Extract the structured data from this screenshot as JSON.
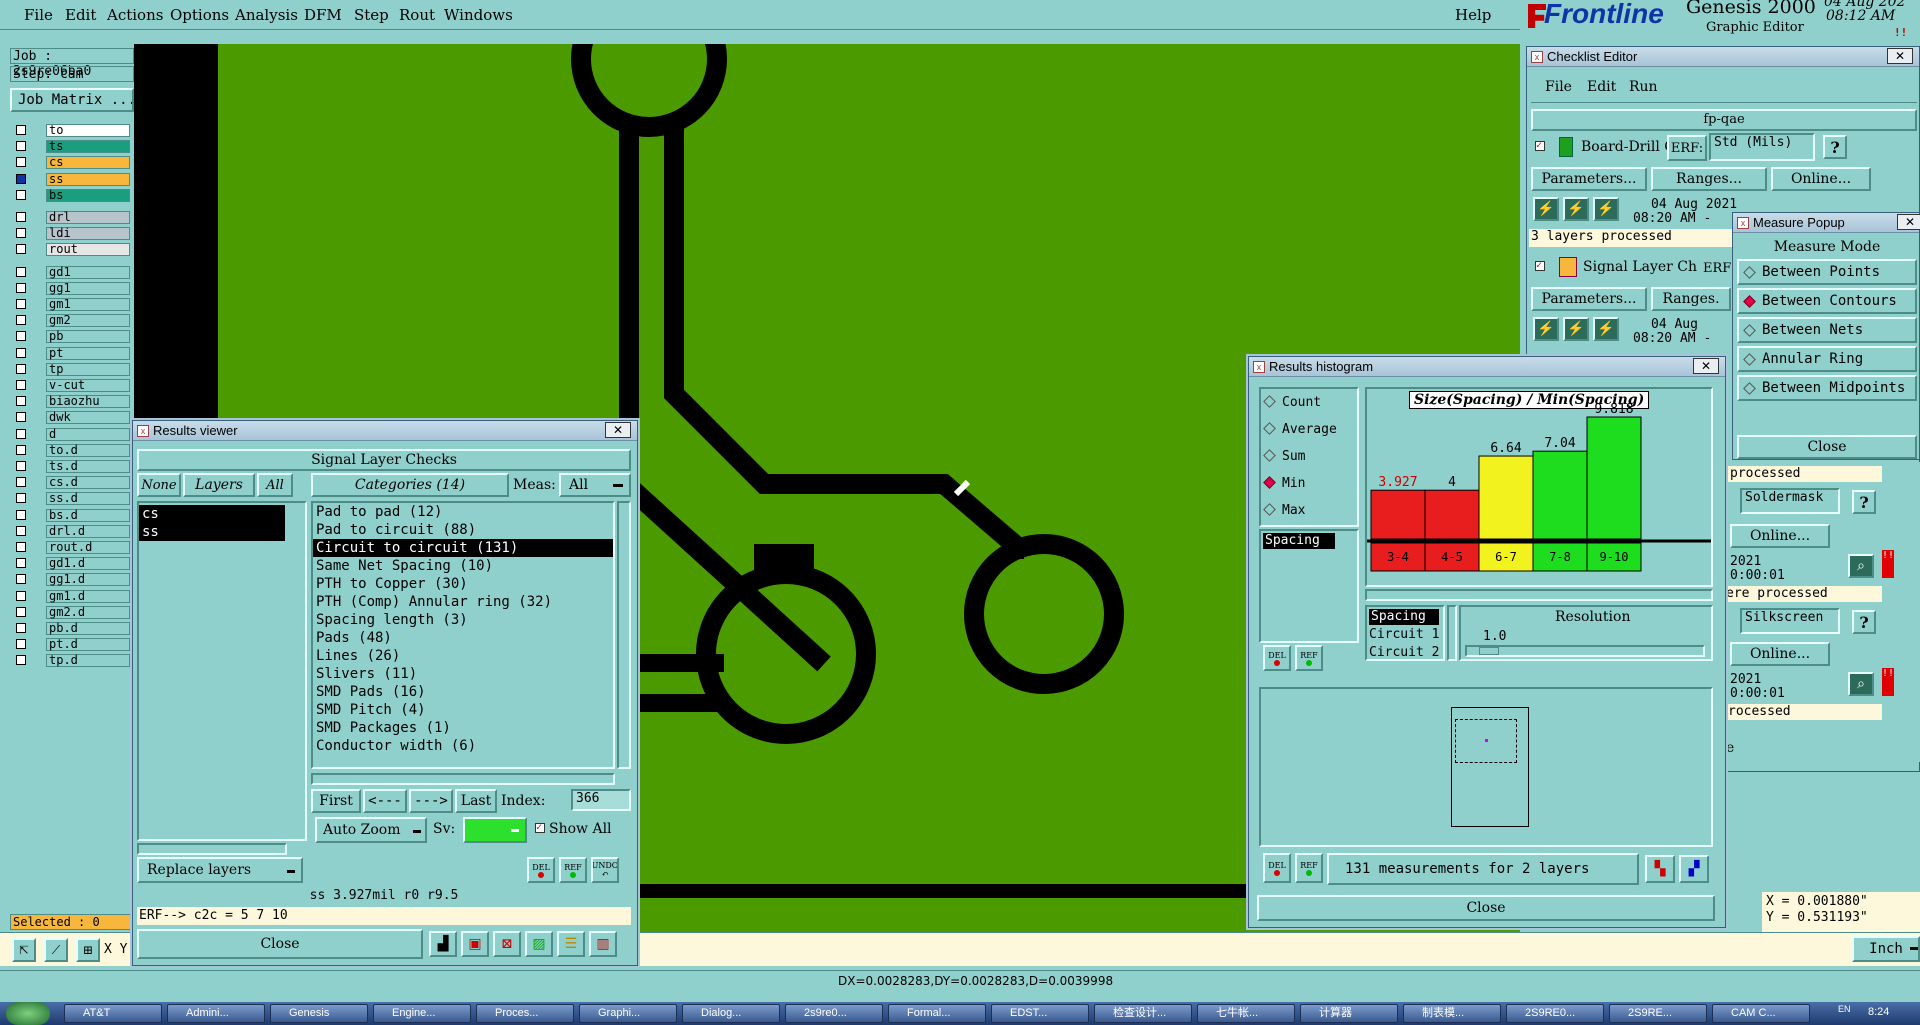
{
  "menu": [
    "File",
    "Edit",
    "Actions",
    "Options",
    "Analysis",
    "DFM",
    "Step",
    "Rout",
    "Windows"
  ],
  "help": "Help",
  "brand": {
    "name": "Frontline",
    "product": "Genesis 2000",
    "subtitle": "Graphic Editor",
    "date": "04 Aug 202",
    "time": "08:12 AM"
  },
  "job": {
    "job": "Job : 2s9re06ba0",
    "step": "Step: cam",
    "matrix": "Job Matrix ..."
  },
  "layers": [
    {
      "name": "to",
      "color": "#ffffff"
    },
    {
      "name": "ts",
      "color": "#1a9e7e"
    },
    {
      "name": "cs",
      "color": "#f6b73c"
    },
    {
      "name": "ss",
      "color": "#f6b73c"
    },
    {
      "name": "bs",
      "color": "#1a9e7e"
    },
    {
      "name": "drl",
      "color": "#b8c4cc"
    },
    {
      "name": "ldi",
      "color": "#b8c4cc"
    },
    {
      "name": "rout",
      "color": "#e6e6e6"
    },
    {
      "name": "gd1",
      "color": "#8fd0cc"
    },
    {
      "name": "gg1",
      "color": "#8fd0cc"
    },
    {
      "name": "gm1",
      "color": "#8fd0cc"
    },
    {
      "name": "gm2",
      "color": "#8fd0cc"
    },
    {
      "name": "pb",
      "color": "#8fd0cc"
    },
    {
      "name": "pt",
      "color": "#8fd0cc"
    },
    {
      "name": "tp",
      "color": "#8fd0cc"
    },
    {
      "name": "v-cut",
      "color": "#8fd0cc"
    },
    {
      "name": "biaozhu",
      "color": "#8fd0cc"
    },
    {
      "name": "dwk",
      "color": "#8fd0cc"
    },
    {
      "name": "d",
      "color": "#8fd0cc"
    },
    {
      "name": "to.d",
      "color": "#8fd0cc"
    },
    {
      "name": "ts.d",
      "color": "#8fd0cc"
    },
    {
      "name": "cs.d",
      "color": "#8fd0cc"
    },
    {
      "name": "ss.d",
      "color": "#8fd0cc"
    },
    {
      "name": "bs.d",
      "color": "#8fd0cc"
    },
    {
      "name": "drl.d",
      "color": "#8fd0cc"
    },
    {
      "name": "rout.d",
      "color": "#8fd0cc"
    },
    {
      "name": "gd1.d",
      "color": "#8fd0cc"
    },
    {
      "name": "gg1.d",
      "color": "#8fd0cc"
    },
    {
      "name": "gm1.d",
      "color": "#8fd0cc"
    },
    {
      "name": "gm2.d",
      "color": "#8fd0cc"
    },
    {
      "name": "pb.d",
      "color": "#8fd0cc"
    },
    {
      "name": "pt.d",
      "color": "#8fd0cc"
    },
    {
      "name": "tp.d",
      "color": "#8fd0cc"
    }
  ],
  "selected": "Selected : 0",
  "status_line": "DX=0.0028283,DY=0.0028283,D=0.0039998",
  "coords": {
    "x": "X = 0.001880\"",
    "y": "Y = 0.531193\""
  },
  "units": "Inch",
  "results_viewer": {
    "title": "Results viewer",
    "header": "Signal Layer Checks",
    "btn_none": "None",
    "btn_layers": "Layers",
    "btn_all": "All",
    "categories_btn": "Categories (14)",
    "meas_label": "Meas:",
    "meas_value": "All",
    "layer_list": [
      "cs",
      "ss"
    ],
    "categories": [
      "Pad to pad (12)",
      "Pad to circuit (88)",
      "Circuit to circuit (131)",
      "Same Net Spacing (10)",
      "PTH to Copper (30)",
      "PTH (Comp) Annular ring (32)",
      "Spacing length (3)",
      "Pads (48)",
      "Lines (26)",
      "Slivers (11)",
      "SMD Pads (16)",
      "SMD Pitch (4)",
      "SMD Packages (1)",
      "Conductor width (6)"
    ],
    "nav": {
      "first": "First",
      "prev": "<---",
      "next": "--->",
      "last": "Last",
      "index_label": "Index:",
      "index_value": "366"
    },
    "auto_zoom": "Auto Zoom",
    "sv": "Sv:",
    "show_all": "Show All",
    "replace_layers": "Replace layers",
    "del": "DEL",
    "ref": "REF",
    "undo": "UNDO",
    "measure_text": "ss 3.927mil  r0  r9.5",
    "erf": "ERF--> c2c = 5 7 10",
    "close": "Close"
  },
  "checklist": {
    "title": "Checklist Editor",
    "menu": [
      "File",
      "Edit",
      "Run"
    ],
    "name": "fp-qae",
    "check1": {
      "name": "Board-Drill Che",
      "erf": "ERF:",
      "std": "Std (Mils)",
      "params": "Parameters...",
      "ranges": "Ranges...",
      "online": "Online...",
      "date": "04 Aug 2021",
      "time": "08:20 AM -",
      "status": "3 layers processed"
    },
    "check2": {
      "name": "Signal Layer Ch",
      "erf": "ERF",
      "params": "Parameters...",
      "ranges": "Ranges.",
      "date": "04 Aug",
      "time": "08:20 AM -"
    },
    "partial": {
      "processed1": "processed",
      "soldermask": "Soldermask",
      "online1": "Online...",
      "date1": "2021",
      "time1": "0:00:01",
      "were": "ere processed",
      "silkscreen": "Silkscreen",
      "online2": "Online...",
      "date2": "2021",
      "time2": "0:00:01",
      "processed2": "rocessed",
      "e": "e"
    }
  },
  "measure_popup": {
    "title": "Measure Popup",
    "heading": "Measure Mode",
    "modes": [
      "Between Points",
      "Between Contours",
      "Between Nets",
      "Annular Ring",
      "Between Midpoints"
    ],
    "selected_index": 1,
    "close": "Close"
  },
  "histogram": {
    "title": "Results histogram",
    "modes": [
      "Count",
      "Average",
      "Sum",
      "Min",
      "Max"
    ],
    "selected_mode": "Min",
    "measure_list": [
      "Spacing"
    ],
    "chart_title": "Size(Spacing) / Min(Spacing)",
    "bars": [
      {
        "range": "3-4",
        "value": "3.927",
        "color": "#e81e1e",
        "label_color": "#d00000",
        "height": 0.4
      },
      {
        "range": "4-5",
        "value": "4",
        "color": "#e81e1e",
        "label_color": "#000000",
        "height": 0.4
      },
      {
        "range": "6-7",
        "value": "6.64",
        "color": "#f2f21e",
        "label_color": "#000000",
        "height": 0.68
      },
      {
        "range": "7-8",
        "value": "7.04",
        "color": "#1edc1e",
        "label_color": "#000000",
        "height": 0.72
      },
      {
        "range": "9-10",
        "value": "9.818",
        "color": "#1edc1e",
        "label_color": "#000000",
        "height": 1.0
      }
    ],
    "fields": [
      "Spacing",
      "Circuit 1",
      "Circuit 2"
    ],
    "resolution_label": "Resolution",
    "resolution_value": "1.0",
    "status": "131 measurements for 2 layers",
    "del": "DEL",
    "ref": "REF",
    "close": "Close"
  },
  "taskbar": [
    "AT&T",
    "Admini...",
    "Genesis",
    "Engine...",
    "Proces...",
    "Graphi...",
    "Dialog...",
    "2s9re0...",
    "Formal...",
    "EDST...",
    "检查设计...",
    "七牛帐...",
    "计算器",
    "制表模...",
    "2S9RE0...",
    "2S9RE...",
    "CAM C..."
  ],
  "tray": {
    "time": "8:24",
    "lang": "EN"
  }
}
